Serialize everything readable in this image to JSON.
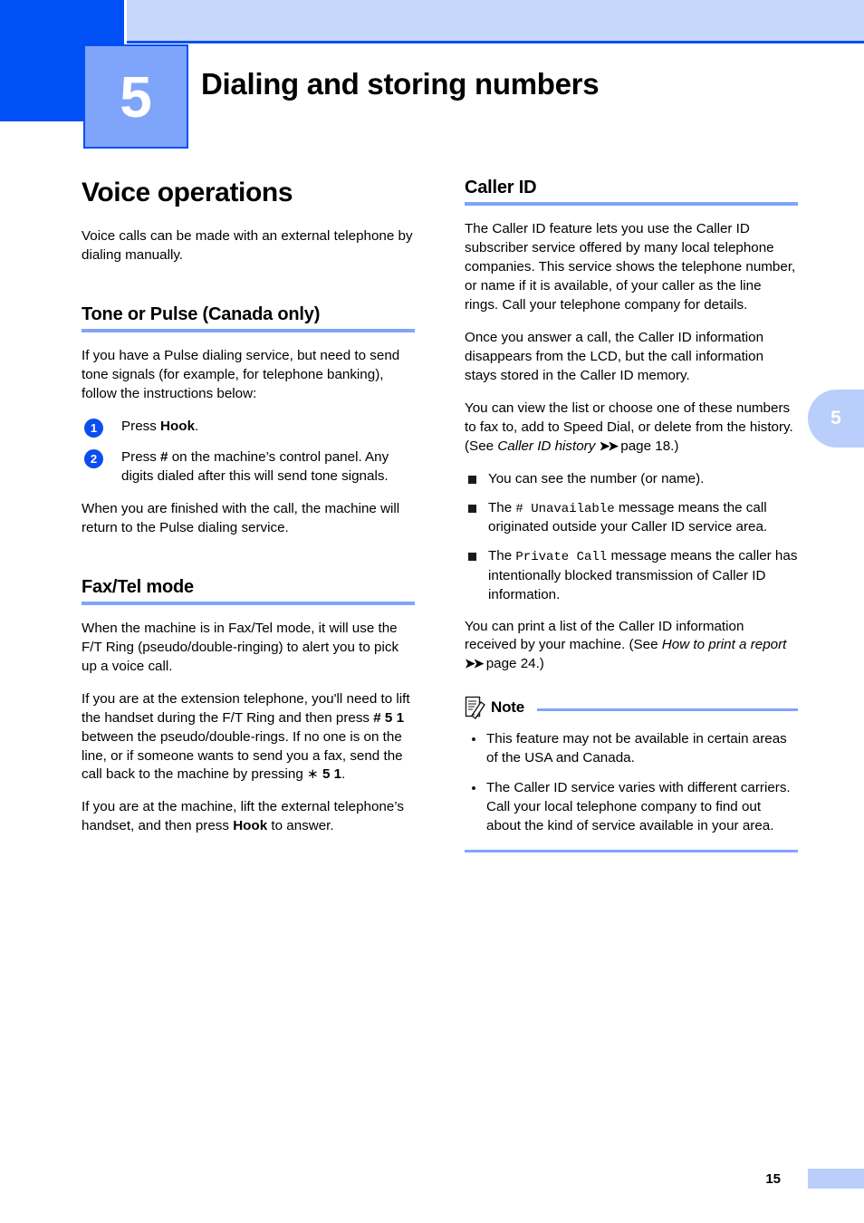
{
  "header": {
    "chapter_number": "5",
    "chapter_title": "Dialing and storing numbers"
  },
  "side_tab": {
    "label": "5"
  },
  "footer": {
    "page_number": "15"
  },
  "left_column": {
    "section_title": "Voice operations",
    "intro": "Voice calls can be made with an external telephone by dialing manually.",
    "tone_or_pulse": {
      "heading": "Tone or Pulse (Canada only)",
      "lead": "If you have a Pulse dialing service, but need to send tone signals (for example, for telephone banking), follow the instructions below:",
      "steps": [
        {
          "num": "1",
          "text_pre": "Press ",
          "text_bold": "Hook",
          "text_post": "."
        },
        {
          "num": "2",
          "text_pre": "Press ",
          "text_bold": "#",
          "text_post": " on the machine’s control panel. Any digits dialed after this will send tone signals."
        }
      ],
      "closing": "When you are finished with the call, the machine will return to the Pulse dialing service."
    },
    "fax_tel_mode": {
      "heading": "Fax/Tel mode",
      "para1": "When the machine is in Fax/Tel mode, it will use the F/T Ring (pseudo/double-ringing) to alert you to pick up a voice call.",
      "para2_a": "If you are at the extension telephone, you'll need to lift the handset during the F/T Ring and then press ",
      "para2_b": "# 5 1",
      "para2_c": " between the pseudo/double-rings. If no one is on the line, or if someone wants to send you a fax, send the call back to the machine by pressing ",
      "para2_d": "∗",
      "para2_e": "5 1",
      "para2_f": ".",
      "para3_a": "If you are at the machine, lift the external telephone’s handset, and then press ",
      "para3_b": "Hook",
      "para3_c": " to answer."
    }
  },
  "right_column": {
    "caller_id": {
      "heading": "Caller ID",
      "para1": "The Caller ID feature lets you use the Caller ID subscriber service offered by many local telephone companies. This service shows the telephone number, or name if it is available, of your caller as the line rings. Call your telephone company for details.",
      "para2": "Once you answer a call, the Caller ID information disappears from the LCD, but the call information stays stored in the Caller ID memory.",
      "para3_a": "You can view the list or choose one of these numbers to fax to, add to Speed Dial, or delete from the history. (See ",
      "para3_italic": "Caller ID history",
      "para3_arrows": "➤➤",
      "para3_b": " page 18.)",
      "bullets": [
        {
          "pre": "You can see the number (or name).",
          "mono": "",
          "post": ""
        },
        {
          "pre": "The ",
          "mono": "# Unavailable",
          "post": " message means the call originated outside your Caller ID service area."
        },
        {
          "pre": "The ",
          "mono": "Private Call",
          "post": " message means the caller has intentionally blocked transmission of Caller ID information."
        }
      ],
      "para4_a": "You can print a list of the Caller ID information received by your machine. (See ",
      "para4_italic": "How to print a report",
      "para4_arrows": "➤➤",
      "para4_b": " page 24.)"
    },
    "note": {
      "label": "Note",
      "items": [
        "This feature may not be available in certain areas of the USA and Canada.",
        "The Caller ID service varies with different carriers. Call your local telephone company to find out about the kind of service available in your area."
      ]
    }
  },
  "colors": {
    "dark_blue": "#0050f5",
    "band_blue": "#c5d8fb",
    "chapter_box_blue": "#7fa5fb",
    "rule_blue": "#7fa5fb",
    "tab_blue": "#b9cefa",
    "step_circle_blue": "#0a4ef0"
  }
}
